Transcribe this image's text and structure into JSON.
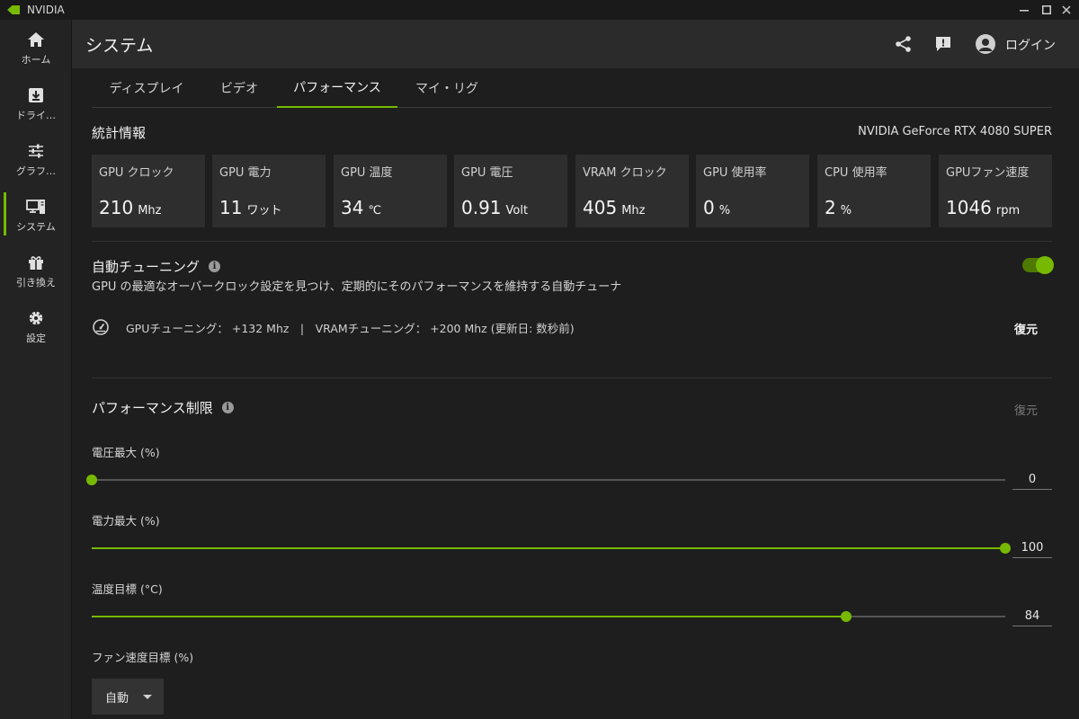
{
  "window": {
    "title": "NVIDIA"
  },
  "sidebar": {
    "items": [
      {
        "label": "ホーム",
        "icon": "home-icon"
      },
      {
        "label": "ドライ…",
        "icon": "driver-download-icon"
      },
      {
        "label": "グラフ…",
        "icon": "graphics-sliders-icon"
      },
      {
        "label": "システム",
        "icon": "system-monitor-icon",
        "active": true
      },
      {
        "label": "引き換え",
        "icon": "gift-icon"
      },
      {
        "label": "設定",
        "icon": "gear-icon"
      }
    ]
  },
  "header": {
    "title": "システム",
    "login_label": "ログイン"
  },
  "tabs": [
    {
      "label": "ディスプレイ"
    },
    {
      "label": "ビデオ"
    },
    {
      "label": "パフォーマンス",
      "active": true
    },
    {
      "label": "マイ・リグ"
    }
  ],
  "stats": {
    "title": "統計情報",
    "gpu_name": "NVIDIA GeForce RTX 4080 SUPER",
    "cards": [
      {
        "label": "GPU クロック",
        "value": "210",
        "unit": "Mhz"
      },
      {
        "label": "GPU 電力",
        "value": "11",
        "unit": "ワット"
      },
      {
        "label": "GPU 温度",
        "value": "34",
        "unit": "℃"
      },
      {
        "label": "GPU 電圧",
        "value": "0.91",
        "unit": "Volt"
      },
      {
        "label": "VRAM クロック",
        "value": "405",
        "unit": "Mhz"
      },
      {
        "label": "GPU 使用率",
        "value": "0",
        "unit": "%"
      },
      {
        "label": "CPU 使用率",
        "value": "2",
        "unit": "%"
      },
      {
        "label": "GPUファン速度",
        "value": "1046",
        "unit": "rpm"
      }
    ]
  },
  "autotune": {
    "title": "自動チューニング",
    "description": "GPU の最適なオーバークロック設定を見つけ、定期的にそのパフォーマンスを維持する自動チューナ",
    "enabled": true,
    "status": "GPUチューニング： +132 Mhz　|　VRAMチューニング： +200 Mhz (更新日: 数秒前)",
    "restore_label": "復元"
  },
  "perf_limits": {
    "title": "パフォーマンス制限",
    "restore_label": "復元",
    "sliders": [
      {
        "label": "電圧最大 (%)",
        "value": "0",
        "fraction": 0.0
      },
      {
        "label": "電力最大 (%)",
        "value": "100",
        "fraction": 1.0
      },
      {
        "label": "温度目標 (°C)",
        "value": "84",
        "fraction": 0.826
      }
    ],
    "fan": {
      "label": "ファン速度目標 (%)",
      "selected": "自動"
    }
  },
  "colors": {
    "accent": "#76b900",
    "background": "#1e1e1e",
    "card": "#2e2e2e",
    "header": "#2b2b2b"
  }
}
